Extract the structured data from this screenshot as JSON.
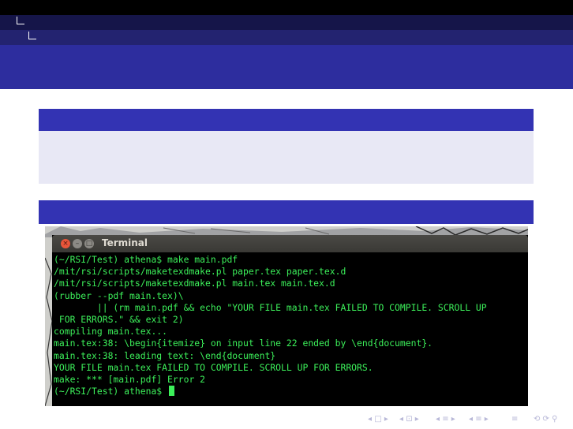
{
  "terminal": {
    "title": "Terminal",
    "lines": [
      "(~/RSI/Test) athena$ make main.pdf",
      "/mit/rsi/scripts/maketexdmake.pl paper.tex paper.tex.d",
      "/mit/rsi/scripts/maketexdmake.pl main.tex main.tex.d",
      "(rubber --pdf main.tex)\\",
      "        || (rm main.pdf && echo \"YOUR FILE main.tex FAILED TO COMPILE. SCROLL UP",
      " FOR ERRORS.\" && exit 2)",
      "compiling main.tex...",
      "main.tex:38: \\begin{itemize} on input line 22 ended by \\end{document}.",
      "main.tex:38: leading text: \\end{document}",
      "YOUR FILE main.tex FAILED TO COMPILE. SCROLL UP FOR ERRORS.",
      "make: *** [main.pdf] Error 2"
    ],
    "prompt": "(~/RSI/Test) athena$ "
  },
  "window_buttons": {
    "close": "×",
    "minimize": "–",
    "maximize": "□"
  },
  "icons": {
    "close": "close-icon",
    "minimize": "minimize-icon",
    "maximize": "maximize-icon",
    "section_corner": "corner-icon"
  },
  "colors": {
    "frame_title": "#2d2d9e",
    "block_title": "#3333b3",
    "block_body": "#e8e8f5",
    "terminal_text": "#3cf05a",
    "terminal_background": "#000000"
  },
  "nav_symbols": {
    "frame": "◂ □ ▸",
    "subsection": "◂ ⊡ ▸",
    "section": "◂ ≡ ▸",
    "doc": "◂ ≡ ▸",
    "align": "≡",
    "search": "⟲ ⟳ ⚲"
  }
}
